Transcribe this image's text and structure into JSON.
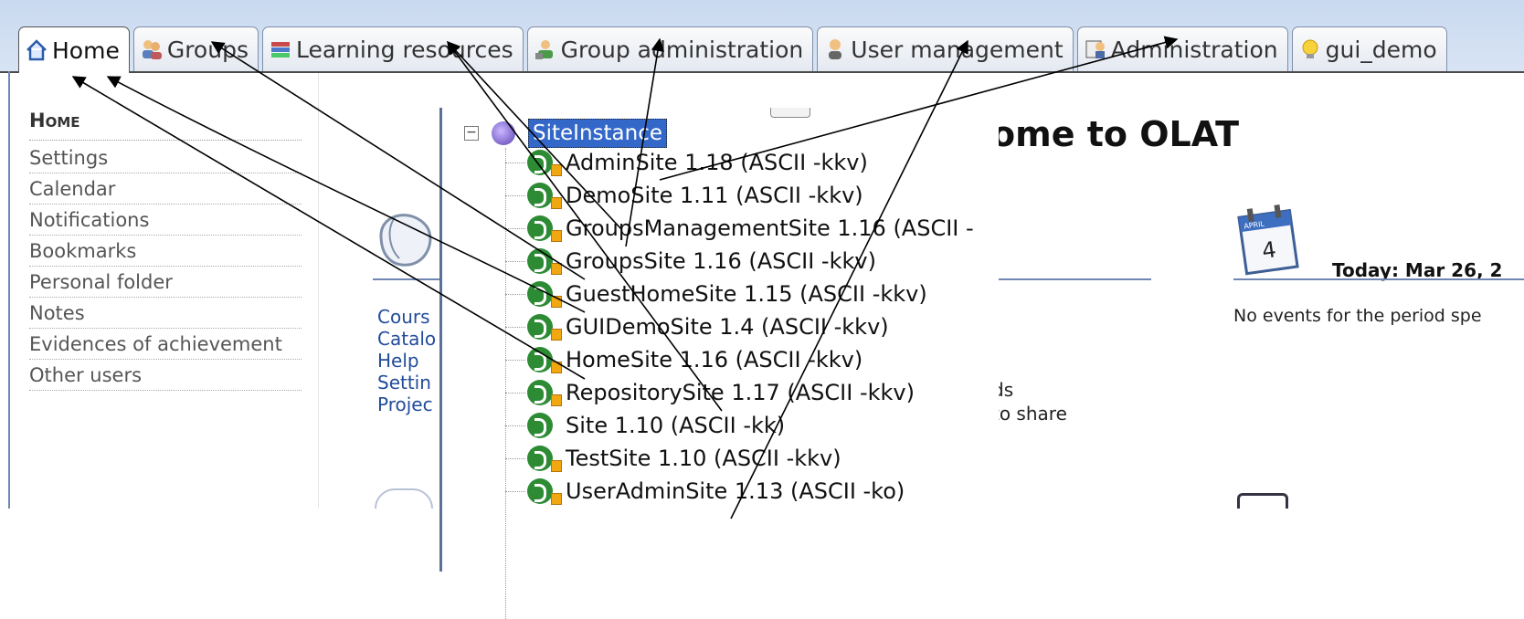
{
  "tabs": [
    {
      "label": "Home",
      "icon": "house-icon",
      "active": true
    },
    {
      "label": "Groups",
      "icon": "people-icon"
    },
    {
      "label": "Learning resources",
      "icon": "books-icon"
    },
    {
      "label": "Group administration",
      "icon": "group-admin-icon"
    },
    {
      "label": "User management",
      "icon": "user-icon"
    },
    {
      "label": "Administration",
      "icon": "admin-icon"
    },
    {
      "label": "gui_demo",
      "icon": "lightbulb-icon"
    }
  ],
  "sidebar": {
    "heading": "Home",
    "items": [
      "Settings",
      "Calendar",
      "Notifications",
      "Bookmarks",
      "Personal folder",
      "Notes",
      "Evidences of achievement",
      "Other users"
    ]
  },
  "main": {
    "links": [
      "Cours",
      "Catalo",
      "Help",
      "Settin",
      "Projec"
    ],
    "welcome": "ome to OLAT",
    "fragment1": "ds",
    "fragment2": "to share",
    "calendar_day": "4",
    "calendar_month": "APRIL",
    "today": "Today: Mar 26, 2",
    "no_events": "No events for the period spe"
  },
  "tree": {
    "root": "SiteInstance",
    "nodes": [
      "AdminSite  1.18  (ASCII -kkv)",
      "DemoSite  1.11  (ASCII -kkv)",
      "GroupsManagementSite  1.16  (ASCII -",
      "GroupsSite  1.16  (ASCII -kkv)",
      "GuestHomeSite  1.15  (ASCII -kkv)",
      "GUIDemoSite  1.4  (ASCII -kkv)",
      "HomeSite  1.16  (ASCII -kkv)",
      "RepositorySite  1.17  (ASCII -kkv)",
      "Site  1.10  (ASCII -kk)",
      "TestSite  1.10  (ASCII -kkv)",
      "UserAdminSite  1.13  (ASCII -ko)"
    ]
  },
  "colors": {
    "tab_band": "#c9d9ef",
    "selection": "#3468c8",
    "node_icon": "#2d8b34",
    "link": "#224c9a"
  }
}
